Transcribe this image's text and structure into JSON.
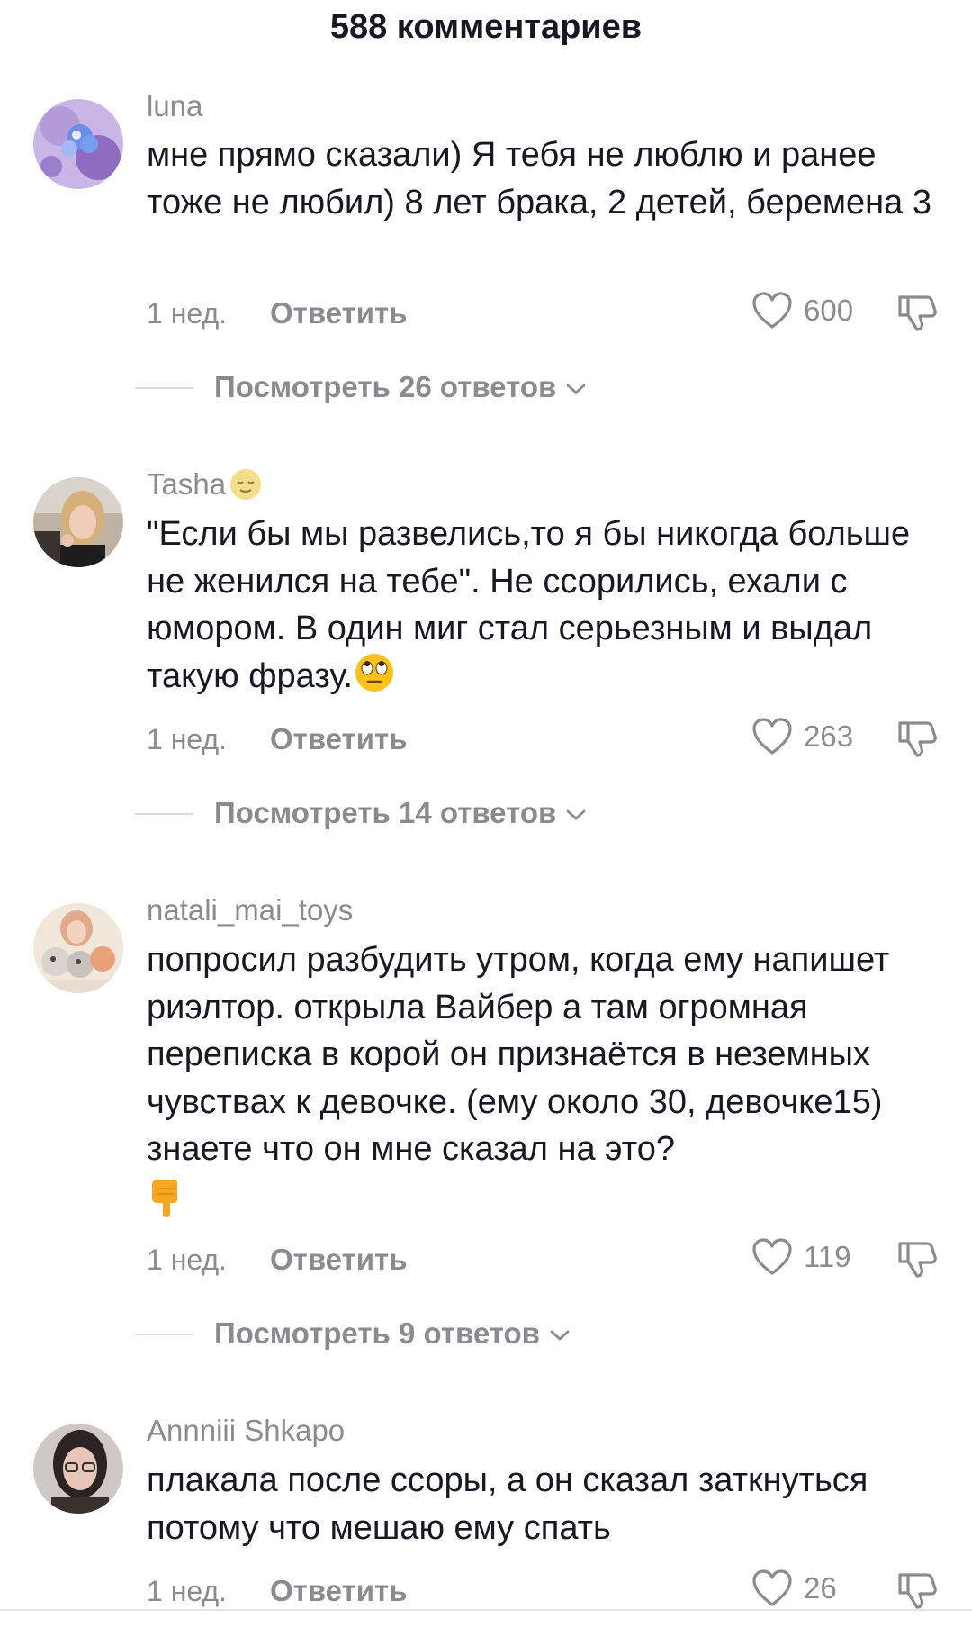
{
  "header": {
    "title": "588 комментариев"
  },
  "comments": [
    {
      "username": "luna",
      "text": "мне прямо сказали) Я тебя не люблю и ранее тоже не любил) 8 лет брака, 2 детей, беремена 3",
      "time": "1 нед.",
      "reply_label": "Ответить",
      "likes": "600",
      "replies_label": "Посмотреть 26 ответов"
    },
    {
      "username": "Tasha",
      "text": "\"Если бы мы развелись,то я бы никогда больше не женился на тебе\". Не ссорились, ехали с юмором. В один миг стал серьезным и выдал такую фразу.",
      "time": "1 нед.",
      "reply_label": "Ответить",
      "likes": "263",
      "replies_label": "Посмотреть 14 ответов"
    },
    {
      "username": "natali_mai_toys",
      "text": "попросил разбудить утром, когда ему напишет риэлтор. открыла Вайбер а там огромная переписка в корой он признаётся в неземных чувствах к девочке. (ему около 30, девочке15) знаете что он мне сказал на это?",
      "time": "1 нед.",
      "reply_label": "Ответить",
      "likes": "119",
      "replies_label": "Посмотреть 9 ответов"
    },
    {
      "username": "Annniii Shkapo",
      "text": "плакала после ссоры, а он сказал заткнуться потому что мешаю ему спать",
      "time": "1 нед.",
      "reply_label": "Ответить",
      "likes": "26"
    }
  ],
  "icons": {
    "like": "heart-outline-icon",
    "dislike": "thumbs-down-outline-icon",
    "expand": "chevron-down-icon",
    "emoji_tasha_name": "relieved-face-emoji",
    "emoji_tasha_text": "face-with-rolling-eyes-emoji",
    "emoji_natali_text": "backhand-index-pointing-down-emoji"
  },
  "colors": {
    "text_primary": "#161823",
    "text_secondary": "#8a8b91",
    "background": "#ffffff"
  }
}
